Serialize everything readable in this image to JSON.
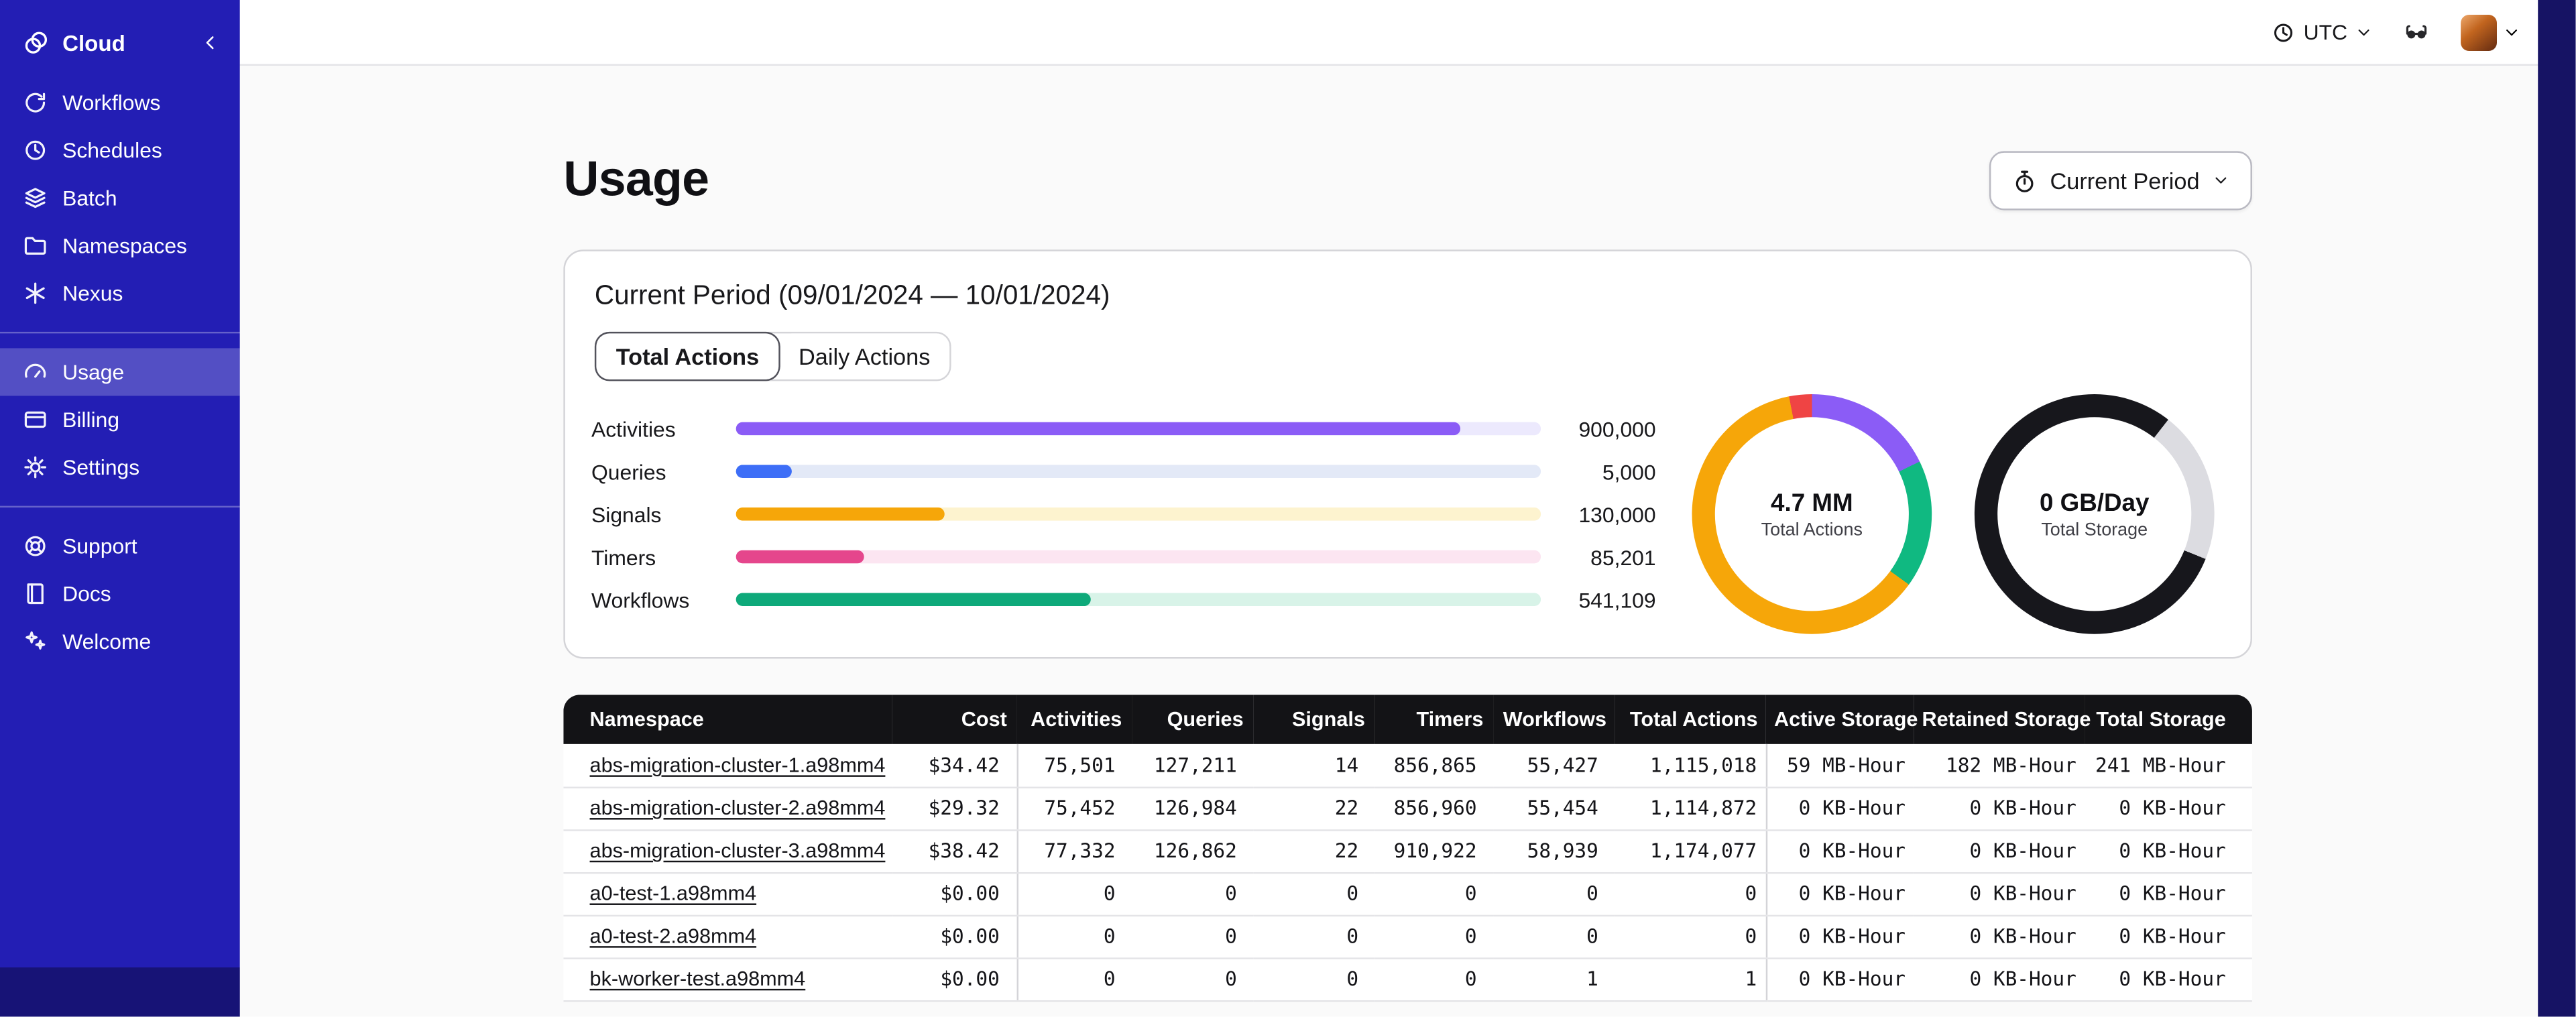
{
  "topbar": {
    "timezone": "UTC"
  },
  "sidebar": {
    "brand": "Cloud",
    "groups": [
      {
        "items": [
          {
            "label": "Workflows",
            "icon": "workflows-icon"
          },
          {
            "label": "Schedules",
            "icon": "schedules-icon"
          },
          {
            "label": "Batch",
            "icon": "batch-icon"
          },
          {
            "label": "Namespaces",
            "icon": "namespaces-icon"
          },
          {
            "label": "Nexus",
            "icon": "nexus-icon"
          }
        ]
      },
      {
        "items": [
          {
            "label": "Usage",
            "icon": "usage-icon",
            "active": true
          },
          {
            "label": "Billing",
            "icon": "billing-icon"
          },
          {
            "label": "Settings",
            "icon": "settings-icon"
          }
        ]
      },
      {
        "items": [
          {
            "label": "Support",
            "icon": "support-icon"
          },
          {
            "label": "Docs",
            "icon": "docs-icon"
          },
          {
            "label": "Welcome",
            "icon": "welcome-icon"
          }
        ]
      }
    ]
  },
  "page": {
    "title": "Usage",
    "period_selector": "Current Period"
  },
  "usage_card": {
    "title": "Current Period (09/01/2024 — 10/01/2024)",
    "tabs": [
      {
        "label": "Total Actions",
        "selected": true
      },
      {
        "label": "Daily Actions",
        "selected": false
      }
    ],
    "bars": [
      {
        "label": "Activities",
        "value": "900,000",
        "fraction": 0.9,
        "color": "#8b5cf6",
        "track": "#ece9fd"
      },
      {
        "label": "Queries",
        "value": "5,000",
        "fraction": 0.07,
        "color": "#3d6ef7",
        "track": "#e3e9f7"
      },
      {
        "label": "Signals",
        "value": "130,000",
        "fraction": 0.26,
        "color": "#f6a609",
        "track": "#fdf3cf"
      },
      {
        "label": "Timers",
        "value": "85,201",
        "fraction": 0.16,
        "color": "#e5468c",
        "track": "#fce5f1"
      },
      {
        "label": "Workflows",
        "value": "541,109",
        "fraction": 0.44,
        "color": "#0ea97a",
        "track": "#d8f3e8"
      }
    ],
    "donuts": [
      {
        "value": "4.7 MM",
        "label": "Total Actions",
        "segments": [
          {
            "color": "#8b5cf6",
            "from": 0,
            "to": 64
          },
          {
            "color": "#10b981",
            "from": 64,
            "to": 126
          },
          {
            "color": "#f6a609",
            "from": 126,
            "to": 349
          },
          {
            "color": "#ef4444",
            "from": 349,
            "to": 360
          }
        ]
      },
      {
        "value": "0 GB/Day",
        "label": "Total Storage",
        "segments": [
          {
            "color": "#17171c",
            "from": 0,
            "to": 38
          },
          {
            "color": "#dcdce1",
            "from": 38,
            "to": 112
          },
          {
            "color": "#17171c",
            "from": 112,
            "to": 360
          }
        ]
      }
    ]
  },
  "usage_table": {
    "columns": [
      "Namespace",
      "Cost",
      "Activities",
      "Queries",
      "Signals",
      "Timers",
      "Workflows",
      "Total Actions",
      "Active Storage",
      "Retained Storage",
      "Total Storage"
    ],
    "rows": [
      [
        "abs-migration-cluster-1.a98mm4",
        "$34.42",
        "75,501",
        "127,211",
        "14",
        "856,865",
        "55,427",
        "1,115,018",
        "59 MB-Hour",
        "182 MB-Hour",
        "241 MB-Hour"
      ],
      [
        "abs-migration-cluster-2.a98mm4",
        "$29.32",
        "75,452",
        "126,984",
        "22",
        "856,960",
        "55,454",
        "1,114,872",
        "0 KB-Hour",
        "0 KB-Hour",
        "0 KB-Hour"
      ],
      [
        "abs-migration-cluster-3.a98mm4",
        "$38.42",
        "77,332",
        "126,862",
        "22",
        "910,922",
        "58,939",
        "1,174,077",
        "0 KB-Hour",
        "0 KB-Hour",
        "0 KB-Hour"
      ],
      [
        "a0-test-1.a98mm4",
        "$0.00",
        "0",
        "0",
        "0",
        "0",
        "0",
        "0",
        "0 KB-Hour",
        "0 KB-Hour",
        "0 KB-Hour"
      ],
      [
        "a0-test-2.a98mm4",
        "$0.00",
        "0",
        "0",
        "0",
        "0",
        "0",
        "0",
        "0 KB-Hour",
        "0 KB-Hour",
        "0 KB-Hour"
      ],
      [
        "bk-worker-test.a98mm4",
        "$0.00",
        "0",
        "0",
        "0",
        "0",
        "1",
        "1",
        "0 KB-Hour",
        "0 KB-Hour",
        "0 KB-Hour"
      ]
    ]
  }
}
